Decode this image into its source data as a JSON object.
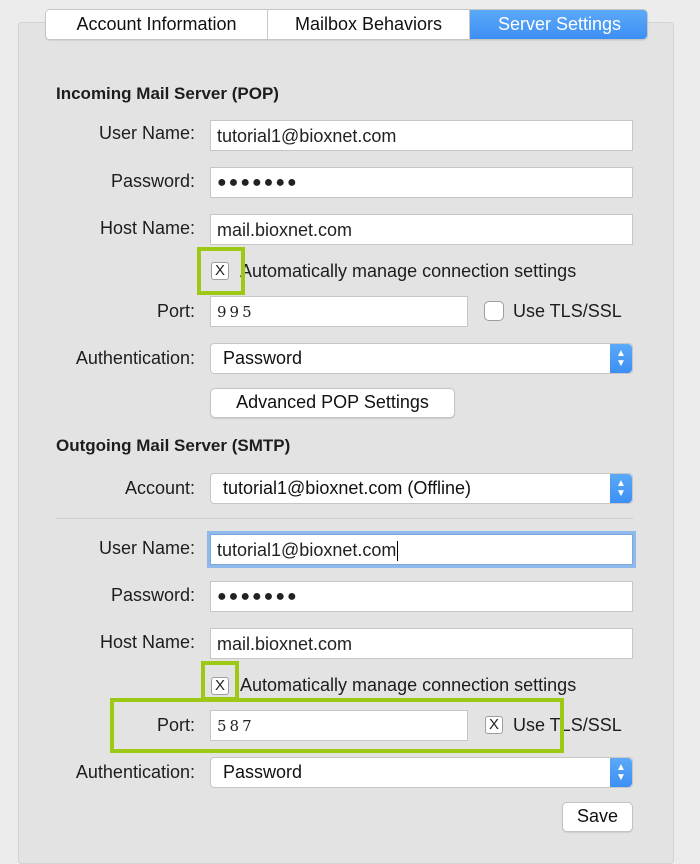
{
  "tabs": [
    {
      "label": "Account Information",
      "active": false
    },
    {
      "label": "Mailbox Behaviors",
      "active": false
    },
    {
      "label": "Server Settings",
      "active": true
    }
  ],
  "incoming": {
    "heading": "Incoming Mail Server (POP)",
    "username_label": "User Name:",
    "username_value": "tutorial1@bioxnet.com",
    "password_label": "Password:",
    "password_value": "●●●●●●●",
    "host_label": "Host Name:",
    "host_value": "mail.bioxnet.com",
    "auto_manage_checked": "X",
    "auto_manage_label": "Automatically manage connection settings",
    "port_label": "Port:",
    "port_value": "995",
    "tls_label": "Use TLS/SSL",
    "auth_label": "Authentication:",
    "auth_value": "Password",
    "advanced_button": "Advanced POP Settings"
  },
  "outgoing": {
    "heading": "Outgoing Mail Server (SMTP)",
    "account_label": "Account:",
    "account_value": "tutorial1@bioxnet.com (Offline)",
    "username_label": "User Name:",
    "username_value": "tutorial1@bioxnet.com",
    "password_label": "Password:",
    "password_value": "●●●●●●●",
    "host_label": "Host Name:",
    "host_value": "mail.bioxnet.com",
    "auto_manage_checked": "X",
    "auto_manage_label": "Automatically manage connection settings",
    "port_label": "Port:",
    "port_value": "587",
    "tls_checked": "X",
    "tls_label": "Use TLS/SSL",
    "auth_label": "Authentication:",
    "auth_value": "Password"
  },
  "save_button": "Save",
  "colors": {
    "accent": "#3d8ff5",
    "highlight": "#9dc814",
    "focus_ring": "#8fb9ea"
  },
  "icons": {
    "popup_arrows": "up-down-chevron-icon"
  }
}
